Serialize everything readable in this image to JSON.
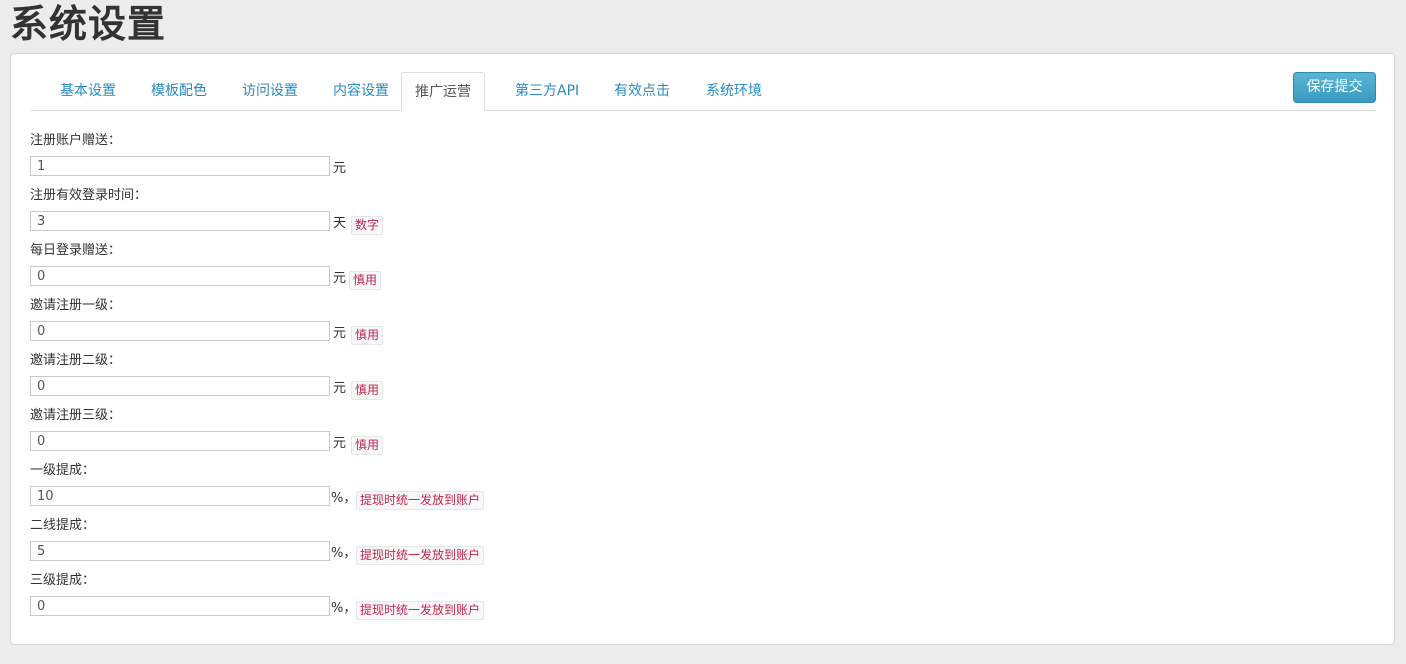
{
  "page": {
    "title": "系统设置"
  },
  "tabs": [
    {
      "label": "基本设置"
    },
    {
      "label": "模板配色"
    },
    {
      "label": "访问设置"
    },
    {
      "label": "内容设置"
    },
    {
      "label": "推广运营",
      "active": true
    },
    {
      "label": "第三方API"
    },
    {
      "label": "有效点击"
    },
    {
      "label": "系统环境"
    }
  ],
  "toolbar": {
    "save_label": "保存提交"
  },
  "form": {
    "fields": [
      {
        "label": "注册账户赠送：",
        "value": "1",
        "unit": "元",
        "hint": ""
      },
      {
        "label": "注册有效登录时间：",
        "value": "3",
        "unit": "天",
        "hint": "数字"
      },
      {
        "label": "每日登录赠送：",
        "value": "0",
        "unit": "元",
        "hint": "慎用"
      },
      {
        "label": "邀请注册一级：",
        "value": "0",
        "unit": "元",
        "hint": "慎用"
      },
      {
        "label": "邀请注册二级：",
        "value": "0",
        "unit": "元",
        "hint": "慎用"
      },
      {
        "label": "邀请注册三级：",
        "value": "0",
        "unit": "元",
        "hint": "慎用"
      },
      {
        "label": "一级提成：",
        "value": "10",
        "unit": "%，",
        "hint": "提现时统一发放到账户"
      },
      {
        "label": "二线提成：",
        "value": "5",
        "unit": "%，",
        "hint": "提现时统一发放到账户"
      },
      {
        "label": "三级提成：",
        "value": "0",
        "unit": "%，",
        "hint": "提现时统一发放到账户"
      }
    ]
  },
  "colors": {
    "link": "#2a8bc0",
    "primary_button": "#3a9ac0",
    "hint_text": "#c0264e"
  }
}
